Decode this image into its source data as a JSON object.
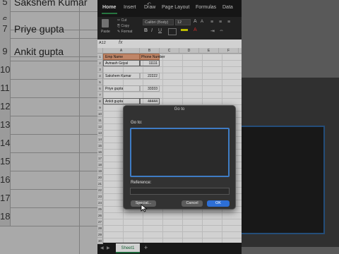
{
  "background_left": {
    "rows": [
      {
        "num": "5",
        "text": "Sakshem Kumar"
      },
      {
        "num": "6",
        "text": ""
      },
      {
        "num": "7",
        "text": "Priye gupta"
      },
      {
        "num": "8",
        "text": ""
      },
      {
        "num": "9",
        "text": "Ankit gupta"
      },
      {
        "num": "10",
        "text": ""
      },
      {
        "num": "11",
        "text": ""
      },
      {
        "num": "12",
        "text": ""
      },
      {
        "num": "13",
        "text": ""
      },
      {
        "num": "14",
        "text": ""
      },
      {
        "num": "15",
        "text": ""
      },
      {
        "num": "16",
        "text": ""
      },
      {
        "num": "17",
        "text": ""
      },
      {
        "num": "18",
        "text": ""
      }
    ]
  },
  "background_right": {
    "title": "Go to"
  },
  "ribbon": {
    "tabs": [
      "Home",
      "Insert",
      "Draw",
      "Page Layout",
      "Formulas",
      "Data"
    ],
    "active_tab": "Home",
    "paste_label": "Paste",
    "cut_label": "Cut",
    "copy_label": "Copy",
    "format_label": "Format",
    "font_name": "Calibri (Body)",
    "font_size": "12",
    "bold": "B",
    "italic": "I",
    "underline": "U"
  },
  "formula_bar": {
    "name_box": "A12",
    "fx": "fx"
  },
  "columns": [
    "A",
    "B",
    "C",
    "D",
    "E",
    "F",
    "G"
  ],
  "row_numbers": [
    "1",
    "2",
    "3",
    "4",
    "5",
    "6",
    "7",
    "8",
    "9",
    "10",
    "11",
    "12",
    "13",
    "14",
    "15",
    "16",
    "17",
    "18",
    "19",
    "20",
    "21",
    "22",
    "23",
    "24",
    "25",
    "26",
    "27",
    "28",
    "29",
    "30"
  ],
  "table": {
    "headers": [
      "Emp Name",
      "Phone Number"
    ],
    "rows": [
      {
        "row": 2,
        "name": "Avinash Goyal",
        "phone": "11111"
      },
      {
        "row": 4,
        "name": "Sakshem Kumar",
        "phone": "22222"
      },
      {
        "row": 6,
        "name": "Priye gupta",
        "phone": "33333"
      },
      {
        "row": 8,
        "name": "Ankit gupta",
        "phone": "44444"
      }
    ]
  },
  "sheet_tabs": {
    "active": "Sheet1",
    "add": "+"
  },
  "dialog": {
    "title": "Go to",
    "goto_label": "Go to:",
    "reference_label": "Reference:",
    "special_button": "Special...",
    "cancel_button": "Cancel",
    "ok_button": "OK",
    "accent": "#2d6fd6"
  },
  "colors": {
    "table_header": "#e9a37e",
    "sheet_accent": "#1f7a44"
  }
}
